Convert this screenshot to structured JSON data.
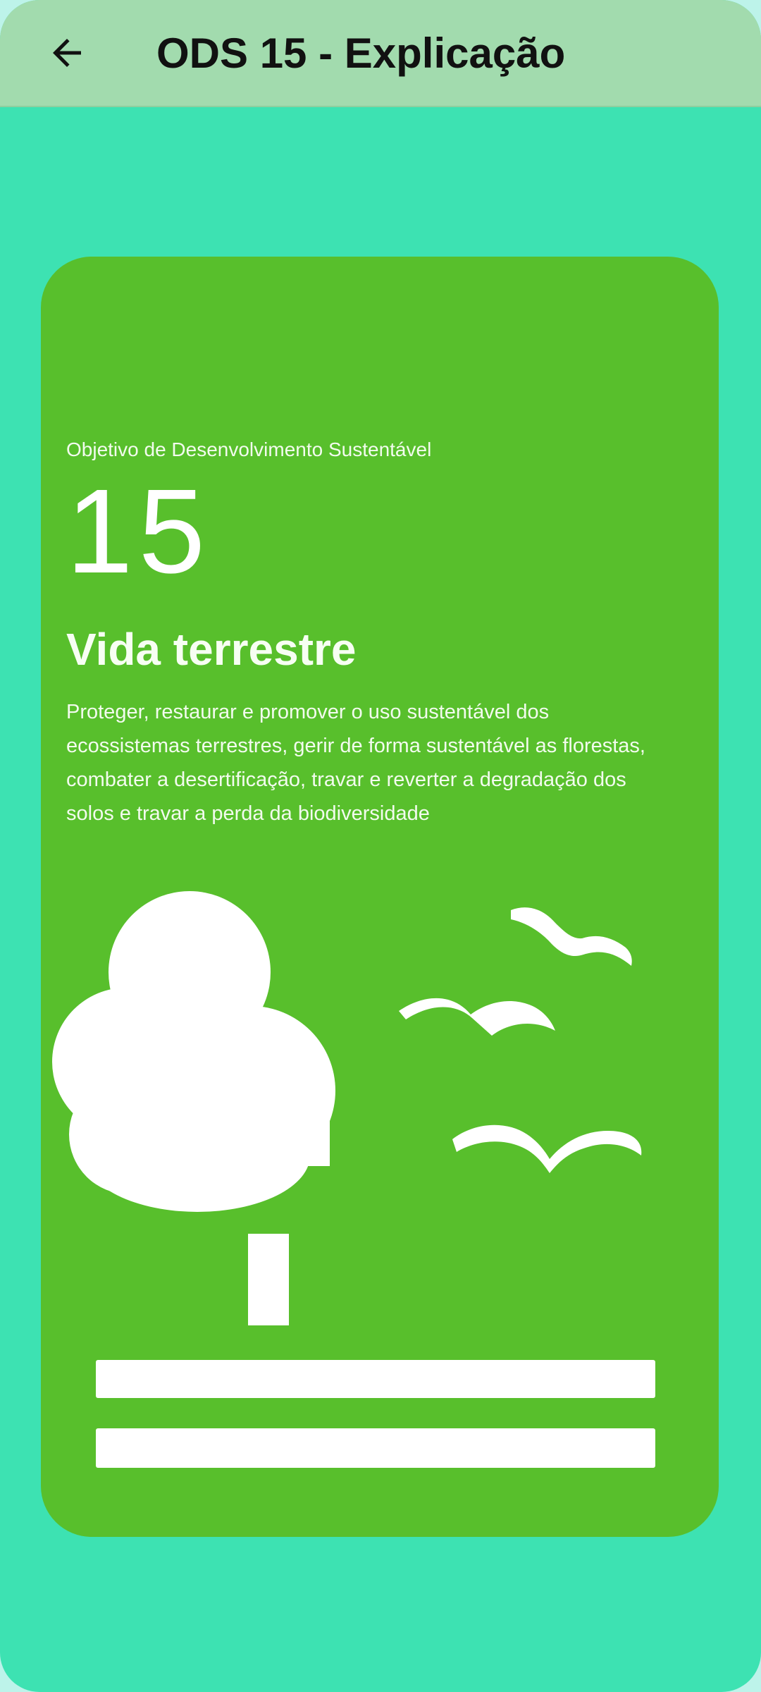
{
  "appbar": {
    "title": "ODS 15 - Explicação",
    "back_icon": "arrow-left-icon"
  },
  "card": {
    "kicker": "Objetivo de Desenvolvimento Sustentável",
    "number": "15",
    "heading": "Vida terrestre",
    "description": "Proteger, restaurar e promover o uso sustentável dos ecossistemas terrestres, gerir de forma sustentável as florestas, combater a desertificação, travar e reverter a degradação dos solos e travar a perda da biodiversidade",
    "illustration": "tree-birds-icon"
  },
  "colors": {
    "screen_background": "#3de2b2",
    "appbar_background": "#a2dbae",
    "card_background": "#58bf2c",
    "illustration": "#ffffff"
  }
}
